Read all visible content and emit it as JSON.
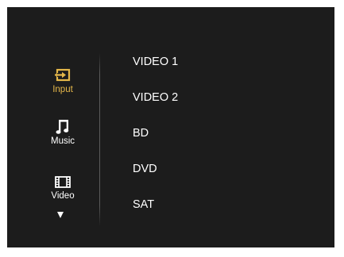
{
  "sidebar": {
    "items": [
      {
        "label": "Input",
        "icon": "input-icon",
        "active": true
      },
      {
        "label": "Music",
        "icon": "music-note-icon",
        "active": false
      },
      {
        "label": "Video",
        "icon": "film-strip-icon",
        "active": false
      }
    ],
    "more_icon": "down-arrow-icon"
  },
  "menu": {
    "items": [
      "VIDEO 1",
      "VIDEO 2",
      "BD",
      "DVD",
      "SAT"
    ]
  },
  "colors": {
    "background": "#1c1c1c",
    "accent": "#e6b84a",
    "text": "#ffffff"
  }
}
